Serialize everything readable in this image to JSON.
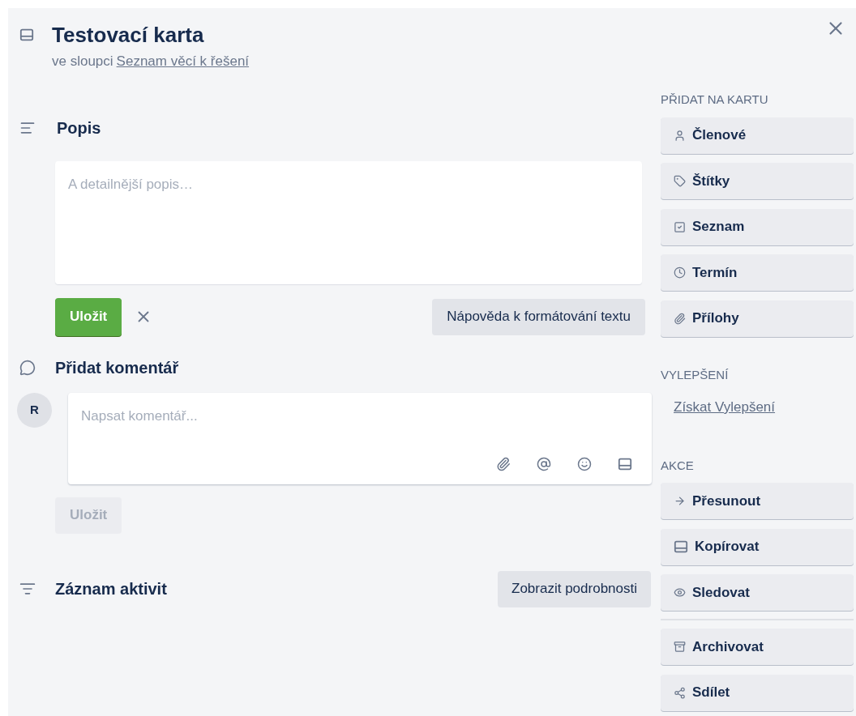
{
  "card": {
    "title": "Testovací karta",
    "list_prefix": "ve sloupci",
    "list_link": "Seznam věcí k řešení"
  },
  "description": {
    "heading": "Popis",
    "placeholder": "A detailnější popis…",
    "save_button": "Uložit",
    "help_button": "Nápověda k formátování textu"
  },
  "comment": {
    "heading": "Přidat komentář",
    "avatar": "R",
    "placeholder": "Napsat komentář...",
    "save_button": "Uložit",
    "save_disabled": true
  },
  "activity": {
    "heading": "Záznam aktivit",
    "details_button": "Zobrazit podrobnosti"
  },
  "sidebar": {
    "add_heading": "PŘIDAT NA KARTU",
    "add_items": [
      "Členové",
      "Štítky",
      "Seznam",
      "Termín",
      "Přílohy"
    ],
    "upgrades_heading": "VYLEPŠENÍ",
    "upgrades_link": "Získat Vylepšení",
    "actions_heading": "AKCE",
    "actions": [
      "Přesunout",
      "Kopírovat",
      "Sledovat"
    ],
    "more_actions": [
      "Archivovat",
      "Sdílet"
    ]
  }
}
